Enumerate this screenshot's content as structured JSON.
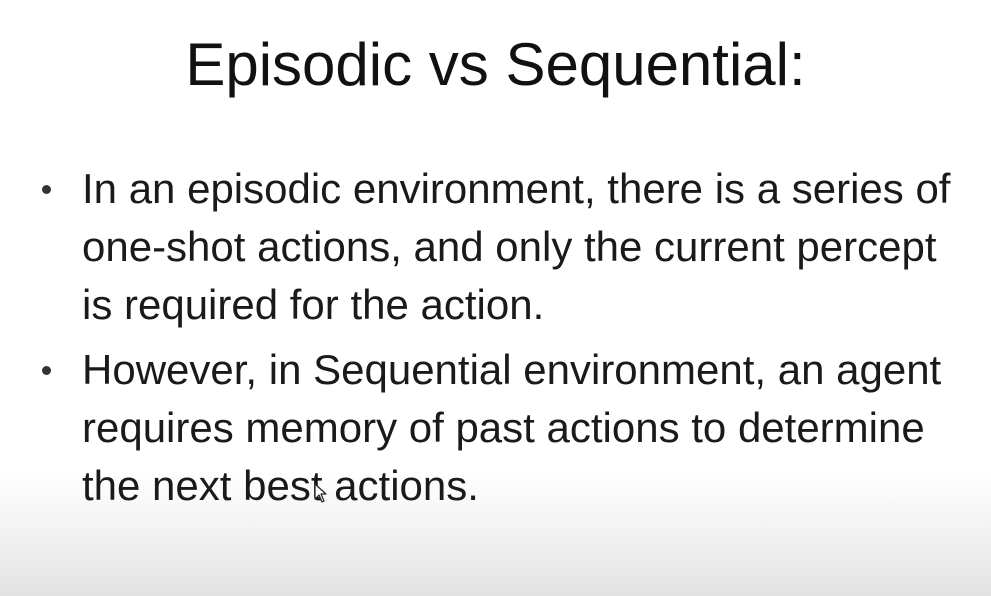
{
  "slide": {
    "title": "Episodic vs Sequential:",
    "bullets": [
      {
        "text": "In an episodic environment, there is a series of one-shot actions, and only the current percept is required for the action."
      },
      {
        "text": "However, in Sequential environment, an agent requires memory of past actions to determine the next best actions."
      }
    ]
  },
  "icons": {
    "bullet": "bullet-dot-icon",
    "pointer": "mouse-pointer-icon"
  },
  "colors": {
    "background": "#ffffff",
    "text": "#111111",
    "footer_shade": "#e2e2e2"
  }
}
